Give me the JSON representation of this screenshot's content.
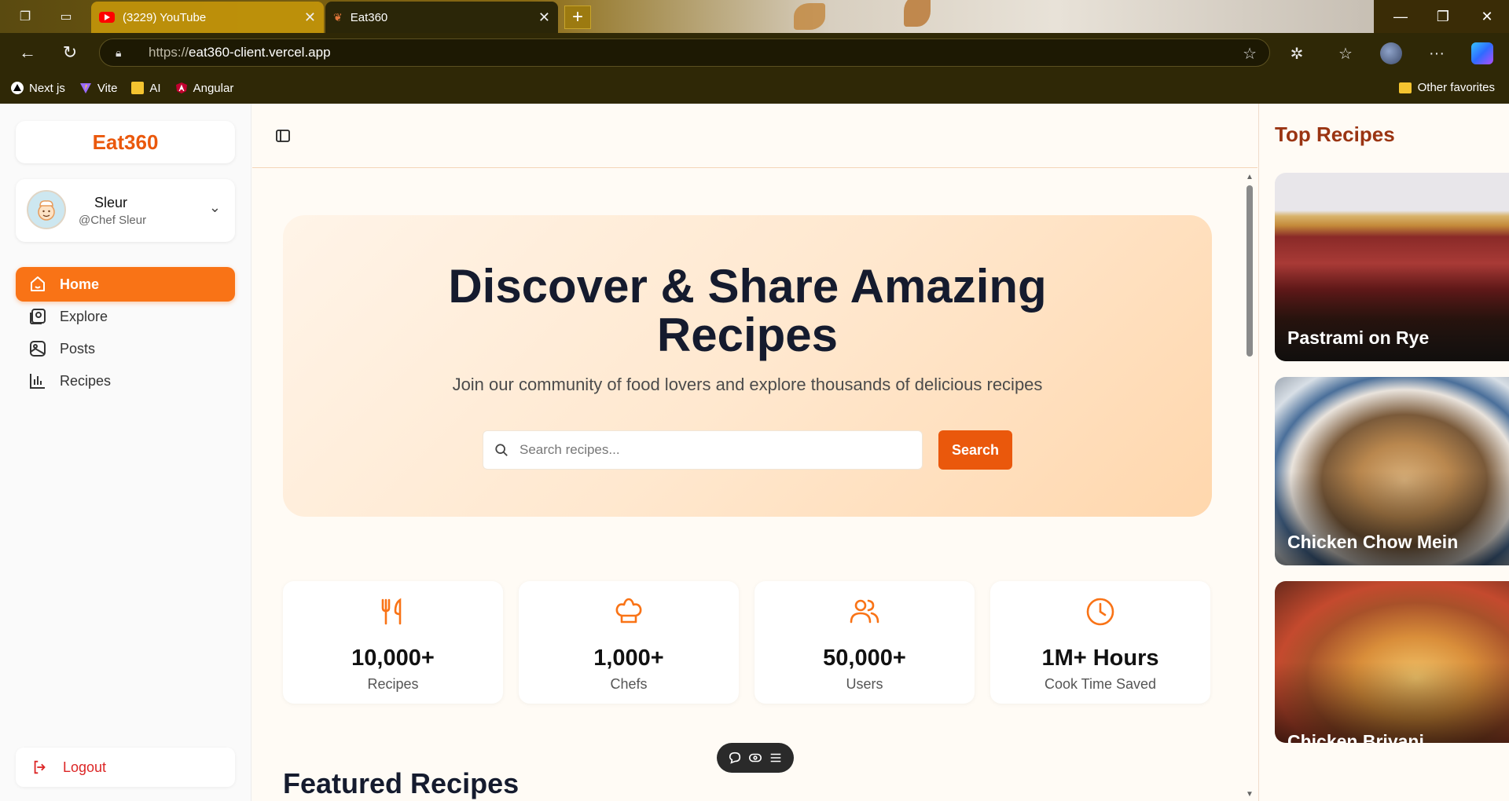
{
  "browser": {
    "tabs": [
      {
        "label": "(3229) YouTube"
      },
      {
        "label": "Eat360"
      }
    ],
    "url_protocol": "https://",
    "url_host": "eat360-client.vercel.app",
    "bookmarks": [
      {
        "label": "Next js"
      },
      {
        "label": "Vite"
      },
      {
        "label": "AI"
      },
      {
        "label": "Angular"
      }
    ],
    "other_favorites": "Other favorites"
  },
  "sidebar": {
    "brand": "Eat360",
    "user": {
      "name": "Sleur",
      "handle": "@Chef Sleur"
    },
    "nav": [
      {
        "label": "Home",
        "icon": "home-icon",
        "active": true
      },
      {
        "label": "Explore",
        "icon": "explore-icon"
      },
      {
        "label": "Posts",
        "icon": "posts-icon"
      },
      {
        "label": "Recipes",
        "icon": "bar-chart-icon"
      }
    ],
    "logout": "Logout"
  },
  "hero": {
    "title_line1": "Discover & Share Amazing",
    "title_line2": "Recipes",
    "subtitle": "Join our community of food lovers and explore thousands of delicious recipes",
    "search_placeholder": "Search recipes...",
    "search_button": "Search"
  },
  "stats": [
    {
      "value": "10,000+",
      "label": "Recipes",
      "icon": "utensils-icon"
    },
    {
      "value": "1,000+",
      "label": "Chefs",
      "icon": "chef-hat-icon"
    },
    {
      "value": "50,000+",
      "label": "Users",
      "icon": "users-icon"
    },
    {
      "value": "1M+ Hours",
      "label": "Cook Time Saved",
      "icon": "clock-icon"
    }
  ],
  "featured_heading": "Featured Recipes",
  "top_recipes": {
    "heading": "Top Recipes",
    "items": [
      {
        "title": "Pastrami on Rye"
      },
      {
        "title": "Chicken Chow Mein"
      },
      {
        "title": "Chicken Briyani"
      }
    ]
  },
  "colors": {
    "accent": "#f97316",
    "brand": "#ea580c",
    "heading": "#151b2e"
  }
}
